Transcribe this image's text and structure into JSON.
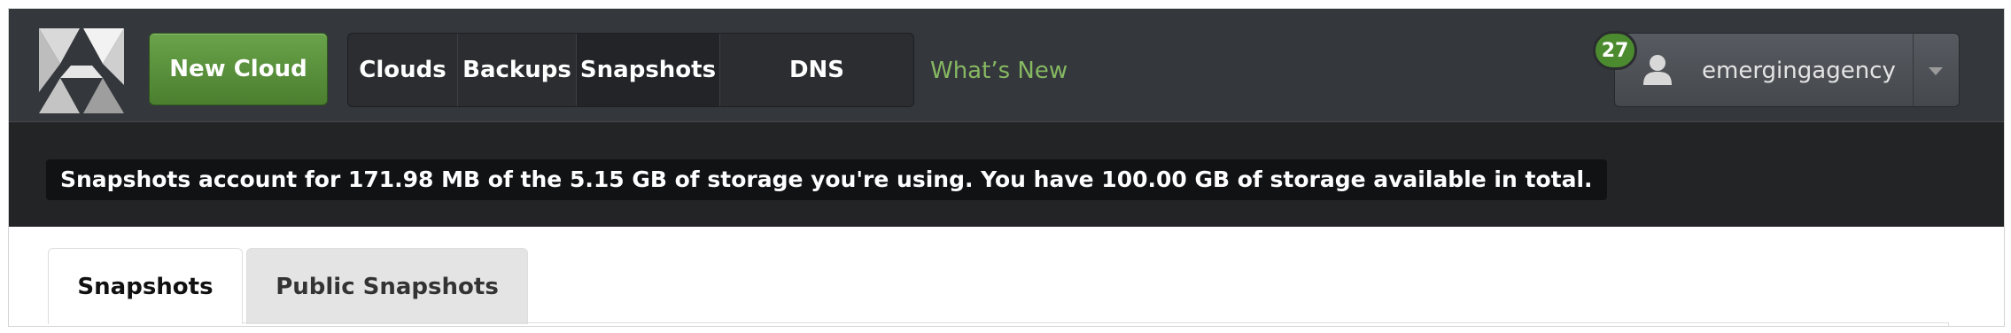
{
  "header": {
    "logo_icon": "x-cube-logo-icon",
    "new_cloud_label": "New Cloud",
    "nav": [
      {
        "label": "Clouds",
        "active": false
      },
      {
        "label": "Backups",
        "active": false
      },
      {
        "label": "Snapshots",
        "active": true
      },
      {
        "label": "DNS",
        "active": false
      }
    ],
    "whats_new_label": "What’s New",
    "notification_count": "27",
    "user": {
      "name": "emergingagency",
      "icon": "user-icon",
      "menu_icon": "chevron-down-icon"
    }
  },
  "info": {
    "message": "Snapshots account for 171.98 MB of the 5.15 GB of storage you're using. You have 100.00 GB of storage available in total."
  },
  "tabs": [
    {
      "label": "Snapshots",
      "active": true
    },
    {
      "label": "Public Snapshots",
      "active": false
    }
  ],
  "colors": {
    "topbar": "#34373c",
    "accent_green": "#4b7f2f",
    "link_green": "#86b861",
    "infobar": "#232426"
  }
}
